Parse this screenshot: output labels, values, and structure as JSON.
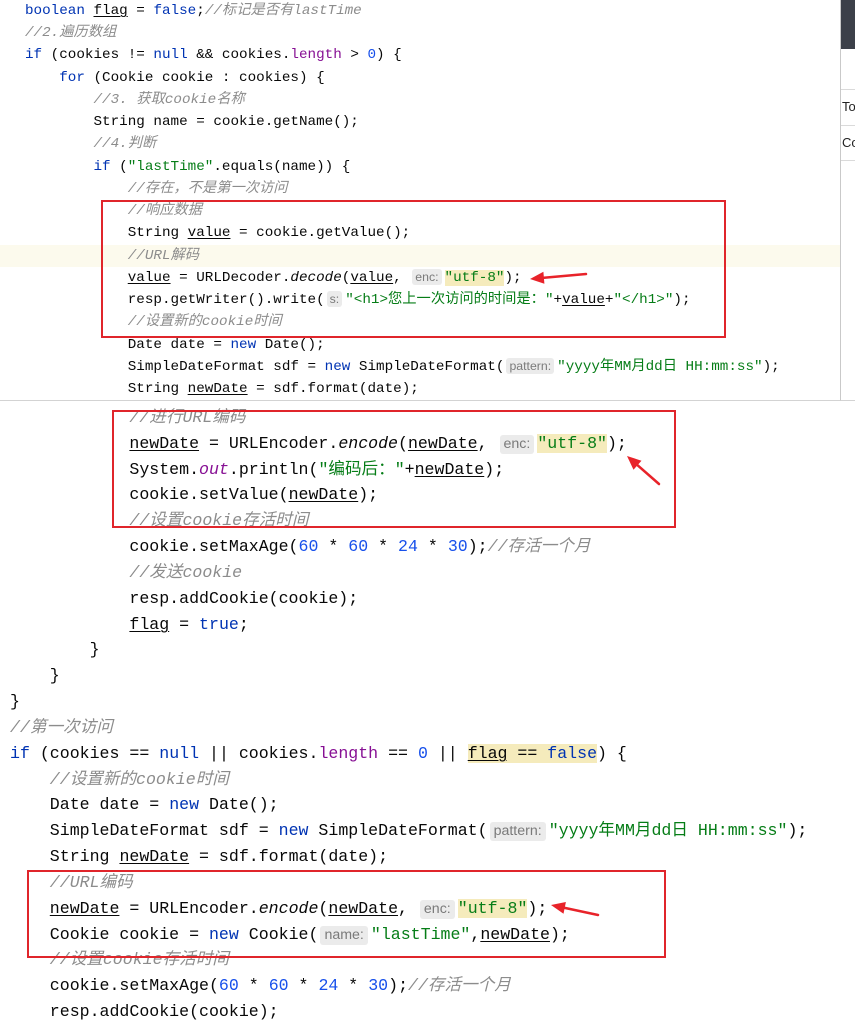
{
  "top_editor": {
    "caret_line": 12,
    "lines": [
      [
        {
          "t": "boolean",
          "c": "#0033b3"
        },
        {
          "t": " "
        },
        {
          "t": "flag",
          "u": true
        },
        {
          "t": " = "
        },
        {
          "t": "false",
          "c": "#0033b3"
        },
        {
          "t": ";"
        },
        {
          "t": "//标记是否有lastTime",
          "c": "#8c8c8c",
          "i": true
        }
      ],
      [
        {
          "t": "//2.遍历数组",
          "c": "#8c8c8c",
          "i": true
        }
      ],
      [
        {
          "t": "if",
          "c": "#0033b3"
        },
        {
          "t": " (cookies != "
        },
        {
          "t": "null",
          "c": "#0033b3"
        },
        {
          "t": " && cookies."
        },
        {
          "t": "length",
          "c": "#871094"
        },
        {
          "t": " > "
        },
        {
          "t": "0",
          "c": "#1750eb"
        },
        {
          "t": ") {"
        }
      ],
      [
        {
          "t": "    "
        },
        {
          "t": "for",
          "c": "#0033b3"
        },
        {
          "t": " (Cookie cookie : cookies) {"
        }
      ],
      [
        {
          "t": "        "
        },
        {
          "t": "//3. 获取cookie名称",
          "c": "#8c8c8c",
          "i": true
        }
      ],
      [
        {
          "t": "        String name = cookie.getName();"
        }
      ],
      [
        {
          "t": "        "
        },
        {
          "t": "//4.判断",
          "c": "#8c8c8c",
          "i": true
        }
      ],
      [
        {
          "t": "        "
        },
        {
          "t": "if",
          "c": "#0033b3"
        },
        {
          "t": " ("
        },
        {
          "t": "\"lastTime\"",
          "c": "#067d17"
        },
        {
          "t": ".equals(name)) {"
        }
      ],
      [
        {
          "t": "            "
        },
        {
          "t": "//存在，不是第一次访问",
          "c": "#8c8c8c",
          "i": true
        }
      ],
      [
        {
          "t": "            "
        },
        {
          "t": "//响应数据",
          "c": "#8c8c8c",
          "i": true
        }
      ],
      [
        {
          "t": "            String "
        },
        {
          "t": "value",
          "u": true
        },
        {
          "t": " = cookie.getValue();"
        }
      ],
      [
        {
          "t": "            "
        },
        {
          "t": "//URL解码",
          "c": "#8c8c8c",
          "i": true
        }
      ],
      [
        {
          "t": "            "
        },
        {
          "t": "value",
          "u": true
        },
        {
          "t": " = URLDecoder."
        },
        {
          "t": "decode",
          "i": true
        },
        {
          "t": "("
        },
        {
          "t": "value",
          "u": true
        },
        {
          "t": ", "
        },
        {
          "t": "enc:",
          "hint": true
        },
        {
          "t": "\"utf-8\"",
          "c": "#067d17",
          "bg": "#f5ebbc"
        },
        {
          "t": ");"
        }
      ],
      [
        {
          "t": "            resp.getWriter().write("
        },
        {
          "t": "s:",
          "hint": true
        },
        {
          "t": "\"<h1>您上一次访问的时间是：\"",
          "c": "#067d17"
        },
        {
          "t": "+"
        },
        {
          "t": "value",
          "u": true
        },
        {
          "t": "+"
        },
        {
          "t": "\"</h1>\"",
          "c": "#067d17"
        },
        {
          "t": ");"
        }
      ],
      [
        {
          "t": "            "
        },
        {
          "t": "//设置新的cookie时间",
          "c": "#8c8c8c",
          "i": true
        }
      ],
      [
        {
          "t": "            Date date = "
        },
        {
          "t": "new",
          "c": "#0033b3"
        },
        {
          "t": " Date();"
        }
      ],
      [
        {
          "t": "            SimpleDateFormat sdf = "
        },
        {
          "t": "new",
          "c": "#0033b3"
        },
        {
          "t": " SimpleDateFormat("
        },
        {
          "t": "pattern:",
          "hint": true
        },
        {
          "t": "\"yyyy年MM月dd日 HH:mm:ss\"",
          "c": "#067d17"
        },
        {
          "t": ");"
        }
      ],
      [
        {
          "t": "            String "
        },
        {
          "t": "newDate",
          "u": true
        },
        {
          "t": " = sdf.format(date);"
        }
      ]
    ]
  },
  "bottom_editor": {
    "lines": [
      [
        {
          "t": "            "
        },
        {
          "t": "//进行URL编码",
          "c": "#8c8c8c",
          "i": true
        }
      ],
      [
        {
          "t": "            "
        },
        {
          "t": "newDate",
          "u": true
        },
        {
          "t": " = URLEncoder."
        },
        {
          "t": "encode",
          "i": true
        },
        {
          "t": "("
        },
        {
          "t": "newDate",
          "u": true
        },
        {
          "t": ", "
        },
        {
          "t": "enc:",
          "hint": true
        },
        {
          "t": "\"utf-8\"",
          "c": "#067d17",
          "bg": "#f5ebbc"
        },
        {
          "t": ");"
        }
      ],
      [
        {
          "t": "            System."
        },
        {
          "t": "out",
          "c": "#871094",
          "i": true
        },
        {
          "t": ".println("
        },
        {
          "t": "\"编码后：\"",
          "c": "#067d17"
        },
        {
          "t": "+"
        },
        {
          "t": "newDate",
          "u": true
        },
        {
          "t": ");"
        }
      ],
      [
        {
          "t": "            cookie.setValue("
        },
        {
          "t": "newDate",
          "u": true
        },
        {
          "t": ");"
        }
      ],
      [
        {
          "t": "            "
        },
        {
          "t": "//设置cookie存活时间",
          "c": "#8c8c8c",
          "i": true
        }
      ],
      [
        {
          "t": "            cookie.setMaxAge("
        },
        {
          "t": "60",
          "c": "#1750eb"
        },
        {
          "t": " * "
        },
        {
          "t": "60",
          "c": "#1750eb"
        },
        {
          "t": " * "
        },
        {
          "t": "24",
          "c": "#1750eb"
        },
        {
          "t": " * "
        },
        {
          "t": "30",
          "c": "#1750eb"
        },
        {
          "t": ");"
        },
        {
          "t": "//存活一个月",
          "c": "#8c8c8c",
          "i": true
        }
      ],
      [
        {
          "t": "            "
        },
        {
          "t": "//发送cookie",
          "c": "#8c8c8c",
          "i": true
        }
      ],
      [
        {
          "t": "            resp.addCookie(cookie);"
        }
      ],
      [
        {
          "t": "            "
        },
        {
          "t": "flag",
          "u": true
        },
        {
          "t": " = "
        },
        {
          "t": "true",
          "c": "#0033b3"
        },
        {
          "t": ";"
        }
      ],
      [
        {
          "t": "        }"
        }
      ],
      [
        {
          "t": "    }"
        }
      ],
      [
        {
          "t": "}"
        }
      ],
      [
        {
          "t": "//第一次访问",
          "c": "#8c8c8c",
          "i": true
        }
      ],
      [
        {
          "t": "if",
          "c": "#0033b3"
        },
        {
          "t": " (cookies == "
        },
        {
          "t": "null",
          "c": "#0033b3"
        },
        {
          "t": " || cookies."
        },
        {
          "t": "length",
          "c": "#871094"
        },
        {
          "t": " == "
        },
        {
          "t": "0",
          "c": "#1750eb"
        },
        {
          "t": " || "
        },
        {
          "t": "flag",
          "u": true,
          "bg": "#f5ebbc"
        },
        {
          "t": " == ",
          "bg": "#f5ebbc"
        },
        {
          "t": "false",
          "c": "#0033b3",
          "bg": "#f5ebbc"
        },
        {
          "t": ") {"
        }
      ],
      [
        {
          "t": "    "
        },
        {
          "t": "//设置新的cookie时间",
          "c": "#8c8c8c",
          "i": true
        }
      ],
      [
        {
          "t": "    Date date = "
        },
        {
          "t": "new",
          "c": "#0033b3"
        },
        {
          "t": " Date();"
        }
      ],
      [
        {
          "t": "    SimpleDateFormat sdf = "
        },
        {
          "t": "new",
          "c": "#0033b3"
        },
        {
          "t": " SimpleDateFormat("
        },
        {
          "t": "pattern:",
          "hint": true
        },
        {
          "t": "\"yyyy年MM月dd日 HH:mm:ss\"",
          "c": "#067d17"
        },
        {
          "t": ");"
        }
      ],
      [
        {
          "t": "    String "
        },
        {
          "t": "newDate",
          "u": true
        },
        {
          "t": " = sdf.format(date);"
        }
      ],
      [
        {
          "t": "    "
        },
        {
          "t": "//URL编码",
          "c": "#8c8c8c",
          "i": true
        }
      ],
      [
        {
          "t": "    "
        },
        {
          "t": "newDate",
          "u": true
        },
        {
          "t": " = URLEncoder."
        },
        {
          "t": "encode",
          "i": true
        },
        {
          "t": "("
        },
        {
          "t": "newDate",
          "u": true
        },
        {
          "t": ", "
        },
        {
          "t": "enc:",
          "hint": true
        },
        {
          "t": "\"utf-8\"",
          "c": "#067d17",
          "bg": "#f5ebbc"
        },
        {
          "t": ");"
        }
      ],
      [
        {
          "t": "    Cookie cookie = "
        },
        {
          "t": "new",
          "c": "#0033b3"
        },
        {
          "t": " Cookie("
        },
        {
          "t": "name:",
          "hint": true
        },
        {
          "t": "\"lastTime\"",
          "c": "#067d17"
        },
        {
          "t": ","
        },
        {
          "t": "newDate",
          "u": true
        },
        {
          "t": ");"
        }
      ],
      [
        {
          "t": "    "
        },
        {
          "t": "//设置cookie存活时间",
          "c": "#8c8c8c",
          "i": true
        }
      ],
      [
        {
          "t": "    cookie.setMaxAge("
        },
        {
          "t": "60",
          "c": "#1750eb"
        },
        {
          "t": " * "
        },
        {
          "t": "60",
          "c": "#1750eb"
        },
        {
          "t": " * "
        },
        {
          "t": "24",
          "c": "#1750eb"
        },
        {
          "t": " * "
        },
        {
          "t": "30",
          "c": "#1750eb"
        },
        {
          "t": ");"
        },
        {
          "t": "//存活一个月",
          "c": "#8c8c8c",
          "i": true
        }
      ],
      [
        {
          "t": "    resp.addCookie(cookie);"
        }
      ]
    ]
  },
  "side_panel": {
    "items": [
      "To",
      "Co"
    ]
  }
}
